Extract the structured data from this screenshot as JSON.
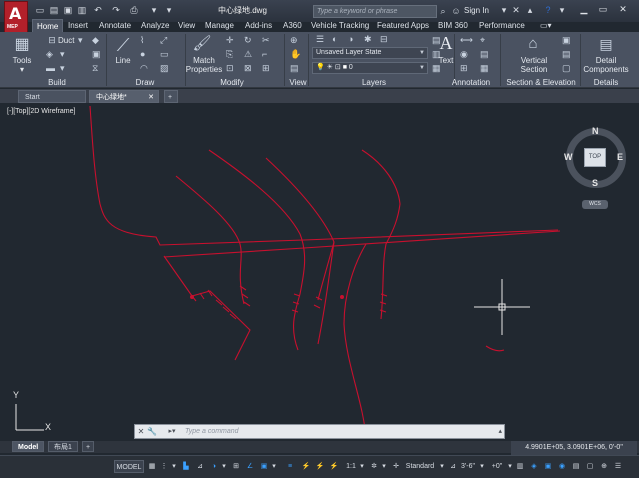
{
  "window": {
    "doc_title": "中心绿地.dwg",
    "search_placeholder": "Type a keyword or phrase",
    "sign_in": "Sign In",
    "app_badge": "MEP"
  },
  "ribbon_tabs": [
    "Home",
    "Insert",
    "Annotate",
    "Analyze",
    "View",
    "Manage",
    "Add-ins",
    "A360",
    "Vehicle Tracking",
    "Featured Apps",
    "BIM 360",
    "Performance"
  ],
  "ribbon": {
    "tools_label": "Tools",
    "duct_label": "Duct",
    "line_label": "Line",
    "match_properties_label": "Match\nProperties",
    "layer_state": "Unsaved Layer State",
    "layer_current": "0",
    "text_label": "Text",
    "vertical_section_label": "Vertical\nSection",
    "detail_components_label": "Detail\nComponents",
    "panels": {
      "build": "Build",
      "draw": "Draw",
      "modify": "Modify",
      "view": "View",
      "layers": "Layers",
      "annotation": "Annotation",
      "section_elevation": "Section & Elevation",
      "details": "Details"
    }
  },
  "file_tabs": [
    "Start",
    "中心绿地*"
  ],
  "viewport": {
    "label": "[-][Top][2D Wireframe]",
    "viewcube_top": "TOP",
    "compass": {
      "n": "N",
      "s": "S",
      "e": "E",
      "w": "W"
    },
    "wcs": "WCS",
    "ucs_x": "X",
    "ucs_y": "Y"
  },
  "command_line": {
    "placeholder": "Type a command"
  },
  "layout_tabs": [
    "Model",
    "布局1"
  ],
  "coordinates": "4.9901E+05, 3.0901E+06, 0'-0\"",
  "status_bar": {
    "model": "MODEL",
    "scale": "1:1",
    "style": "Standard",
    "dim": "3'-6\"",
    "offset": "+0\""
  },
  "colors": {
    "background": "#212830",
    "ribbon": "#4a5261",
    "drawing_lines": "#c8102e",
    "app_red": "#b2202a"
  }
}
